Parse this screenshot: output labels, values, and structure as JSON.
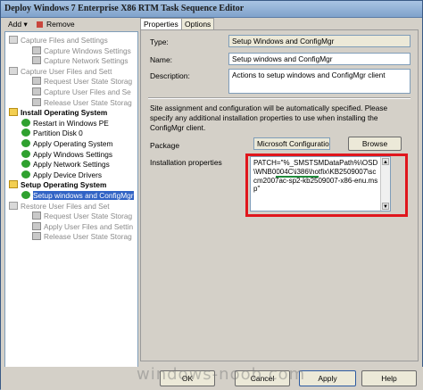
{
  "window": {
    "title": "Deploy Windows 7 Enterprise X86 RTM Task Sequence Editor"
  },
  "toolbar": {
    "add_label": "Add ▾",
    "remove_label": "Remove"
  },
  "tree": [
    {
      "label": "Capture Files and Settings",
      "state": "group-disabled",
      "icon": "folder-icon"
    },
    {
      "label": "Capture Windows Settings",
      "state": "disabled",
      "icon": "step-icon"
    },
    {
      "label": "Capture Network Settings",
      "state": "disabled",
      "icon": "step-icon"
    },
    {
      "label": "Capture User Files and Sett",
      "state": "group-disabled",
      "icon": "folder-icon"
    },
    {
      "label": "Request User State Storag",
      "state": "disabled",
      "icon": "step-icon"
    },
    {
      "label": "Capture User Files and Se",
      "state": "disabled",
      "icon": "step-icon"
    },
    {
      "label": "Release User State Storag",
      "state": "disabled",
      "icon": "step-icon"
    },
    {
      "label": "Install Operating System",
      "state": "group",
      "icon": "folder-icon"
    },
    {
      "label": "Restart in Windows PE",
      "state": "normal",
      "icon": "check-icon"
    },
    {
      "label": "Partition Disk 0",
      "state": "normal",
      "icon": "check-icon"
    },
    {
      "label": "Apply Operating System",
      "state": "normal",
      "icon": "check-icon"
    },
    {
      "label": "Apply Windows Settings",
      "state": "normal",
      "icon": "check-icon"
    },
    {
      "label": "Apply Network Settings",
      "state": "normal",
      "icon": "check-icon"
    },
    {
      "label": "Apply Device Drivers",
      "state": "normal",
      "icon": "check-icon"
    },
    {
      "label": "Setup Operating System",
      "state": "group",
      "icon": "folder-icon"
    },
    {
      "label": "Setup windows and ConfigMgr",
      "state": "selected",
      "icon": "check-icon"
    },
    {
      "label": "Restore User Files and Set",
      "state": "group-disabled",
      "icon": "folder-icon"
    },
    {
      "label": "Request User State Storag",
      "state": "disabled",
      "icon": "step-icon"
    },
    {
      "label": "Apply User Files and Settin",
      "state": "disabled",
      "icon": "step-icon"
    },
    {
      "label": "Release User State Storag",
      "state": "disabled",
      "icon": "step-icon"
    }
  ],
  "tabs": {
    "properties": "Properties",
    "options": "Options"
  },
  "props": {
    "type_label": "Type:",
    "type_value": "Setup Windows and ConfigMgr",
    "name_label": "Name:",
    "name_value": "Setup windows and ConfigMgr",
    "description_label": "Description:",
    "description_value": "Actions to setup windows and ConfigMgr client",
    "info_text": "Site assignment and configuration will be automatically specified. Please specify any additional installation properties to use when installing the ConfigMgr client.",
    "package_label": "Package",
    "package_value": "Microsoft Configuration",
    "browse_label": "Browse",
    "installation_properties_label": "Installation properties",
    "installation_properties_value": "PATCH=\"%_SMSTSMDataPath%\\OSD\\WNB0004C\\i386\\hotfix\\KB2509007\\sccm2007ac-sp2-kb2509007-x86-enu.msp\""
  },
  "buttons": {
    "ok": "OK",
    "cancel": "Cancel",
    "apply": "Apply",
    "help": "Help"
  },
  "watermark": "windows-noob.com",
  "colors": {
    "highlight": "#e0161d",
    "underline": "#1f8b3b",
    "selection": "#3163c5"
  }
}
